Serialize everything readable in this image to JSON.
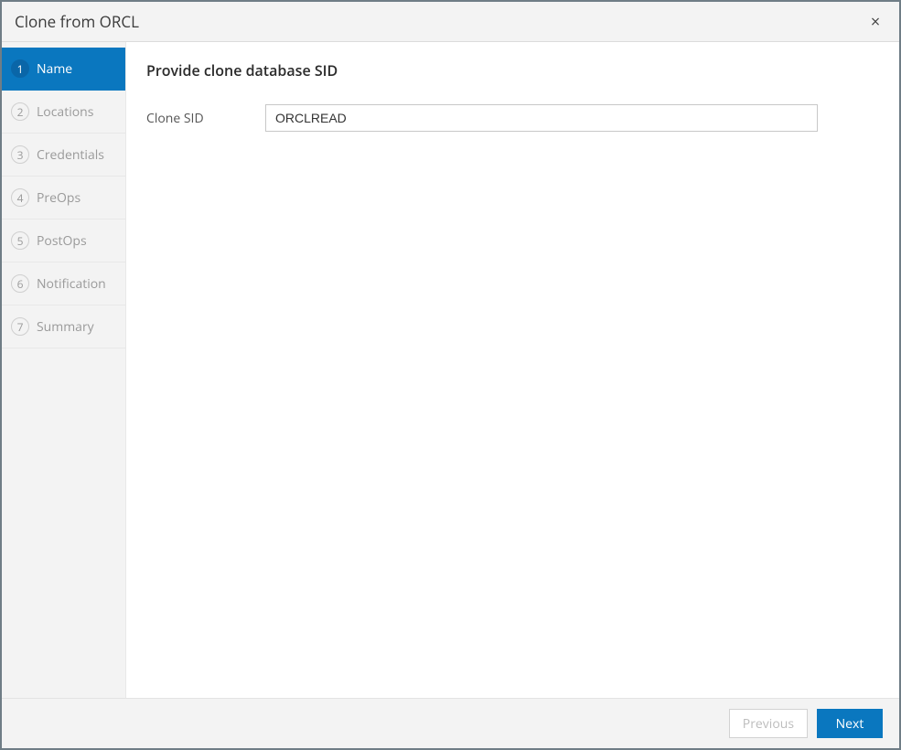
{
  "dialog": {
    "title": "Clone from ORCL",
    "close_symbol": "×"
  },
  "sidebar": {
    "steps": [
      {
        "num": "1",
        "label": "Name",
        "active": true
      },
      {
        "num": "2",
        "label": "Locations",
        "active": false
      },
      {
        "num": "3",
        "label": "Credentials",
        "active": false
      },
      {
        "num": "4",
        "label": "PreOps",
        "active": false
      },
      {
        "num": "5",
        "label": "PostOps",
        "active": false
      },
      {
        "num": "6",
        "label": "Notification",
        "active": false
      },
      {
        "num": "7",
        "label": "Summary",
        "active": false
      }
    ]
  },
  "content": {
    "heading": "Provide clone database SID",
    "clone_sid_label": "Clone SID",
    "clone_sid_value": "ORCLREAD"
  },
  "footer": {
    "previous_label": "Previous",
    "next_label": "Next"
  }
}
